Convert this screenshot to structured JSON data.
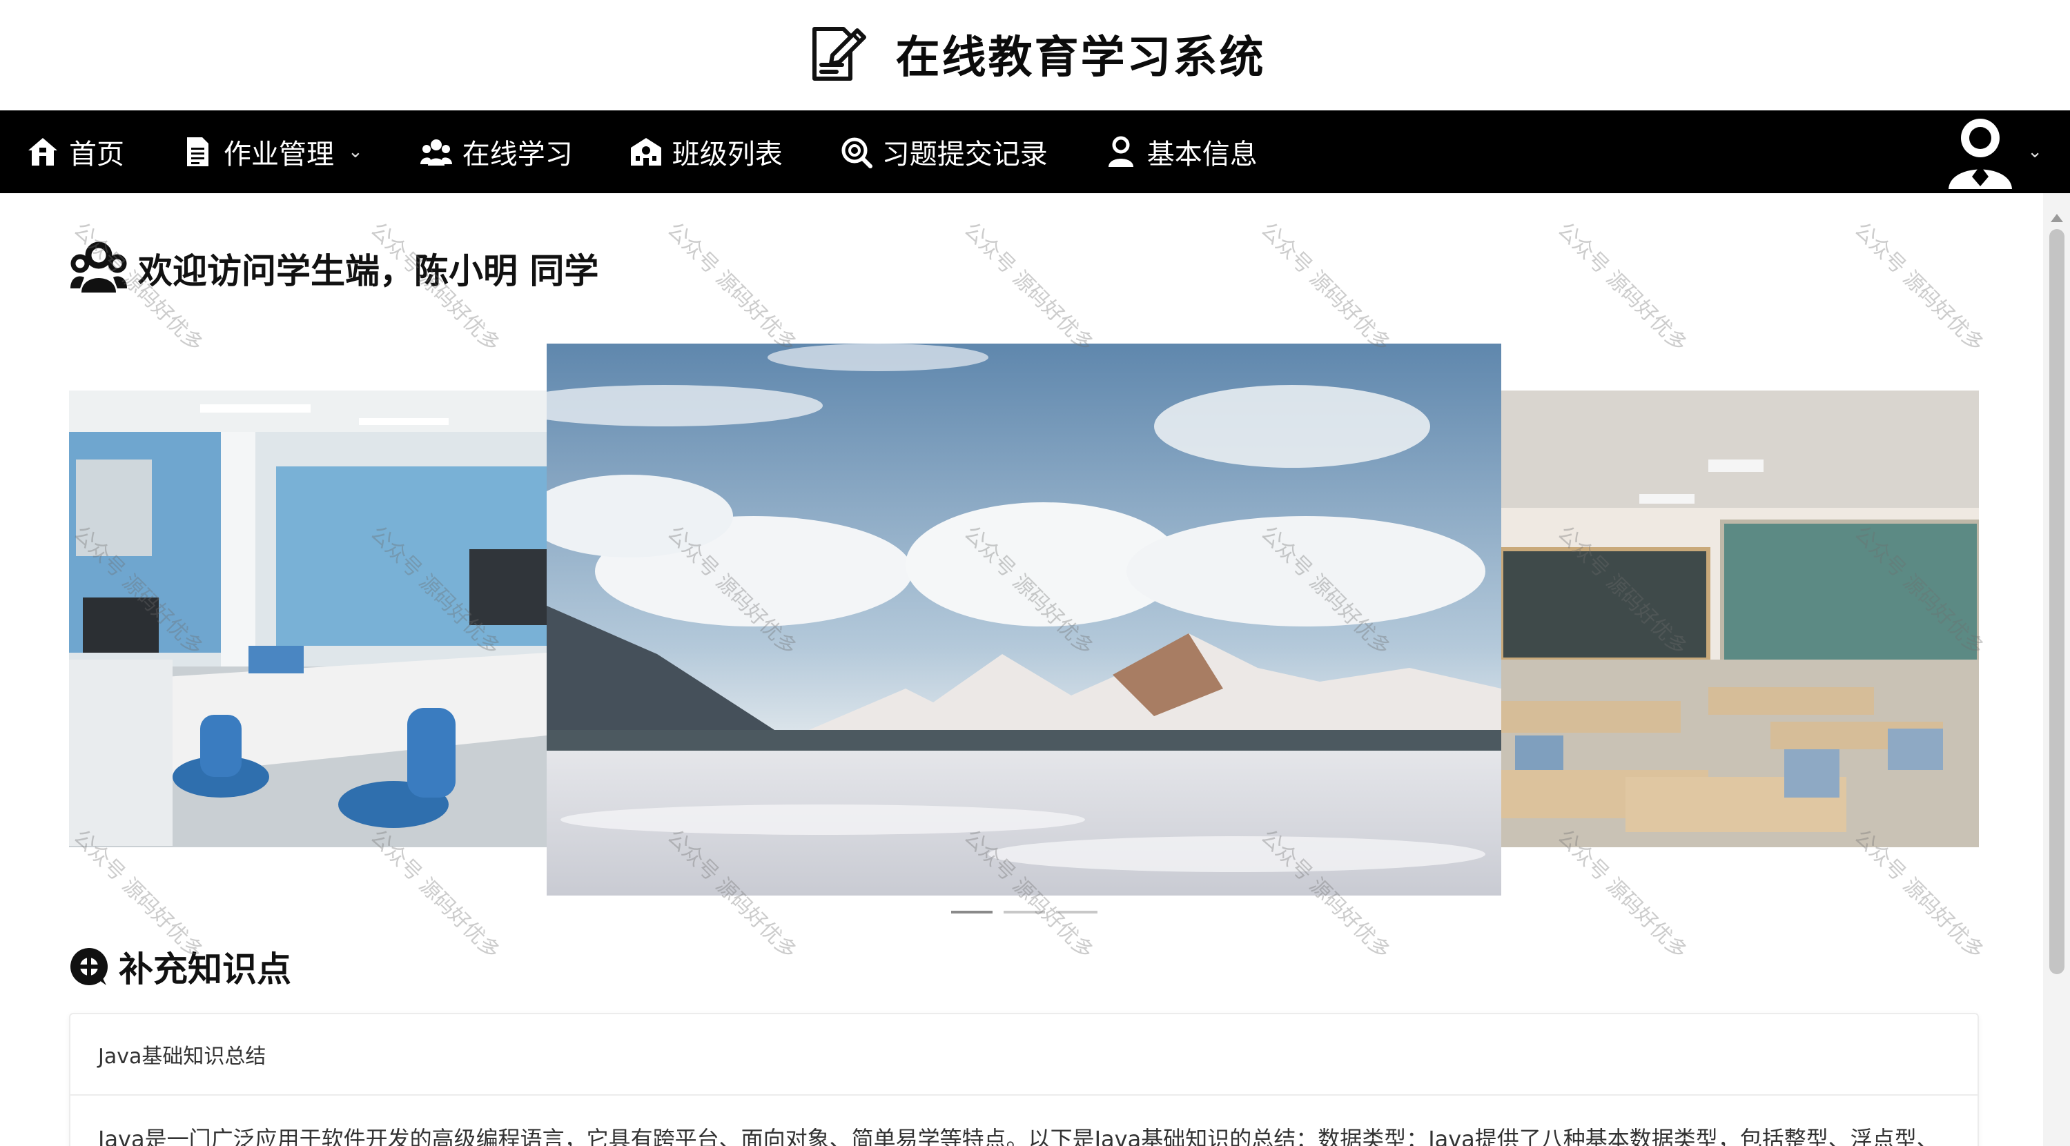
{
  "header": {
    "title": "在线教育学习系统",
    "logo_icon": "pen-note-icon"
  },
  "nav": {
    "items": [
      {
        "label": "首页",
        "icon": "home-icon"
      },
      {
        "label": "作业管理",
        "icon": "document-icon",
        "has_dropdown": true
      },
      {
        "label": "在线学习",
        "icon": "group-icon"
      },
      {
        "label": "班级列表",
        "icon": "school-icon"
      },
      {
        "label": "习题提交记录",
        "icon": "search-record-icon"
      },
      {
        "label": "基本信息",
        "icon": "user-icon"
      }
    ],
    "user_menu_icon": "avatar-icon"
  },
  "welcome": {
    "text": "欢迎访问学生端，陈小明 同学",
    "icon": "users-icon"
  },
  "carousel": {
    "slides": [
      "office scene",
      "mountain sky landscape",
      "classroom"
    ],
    "active_index": 0,
    "indicator_count": 3
  },
  "knowledge": {
    "section_title": "补充知识点",
    "section_icon": "plus-circle-icon",
    "card_title": "Java基础知识总结",
    "card_body": "Java是一门广泛应用于软件开发的高级编程语言，它具有跨平台、面向对象、简单易学等特点。以下是Java基础知识的总结：数据类型：Java提供了八种基本数据类型，包括整型、浮点型、"
  },
  "watermark": {
    "text": "公众号 源码好优多"
  },
  "colors": {
    "nav_bg": "#000000",
    "nav_text": "#ffffff",
    "page_bg": "#ffffff"
  }
}
